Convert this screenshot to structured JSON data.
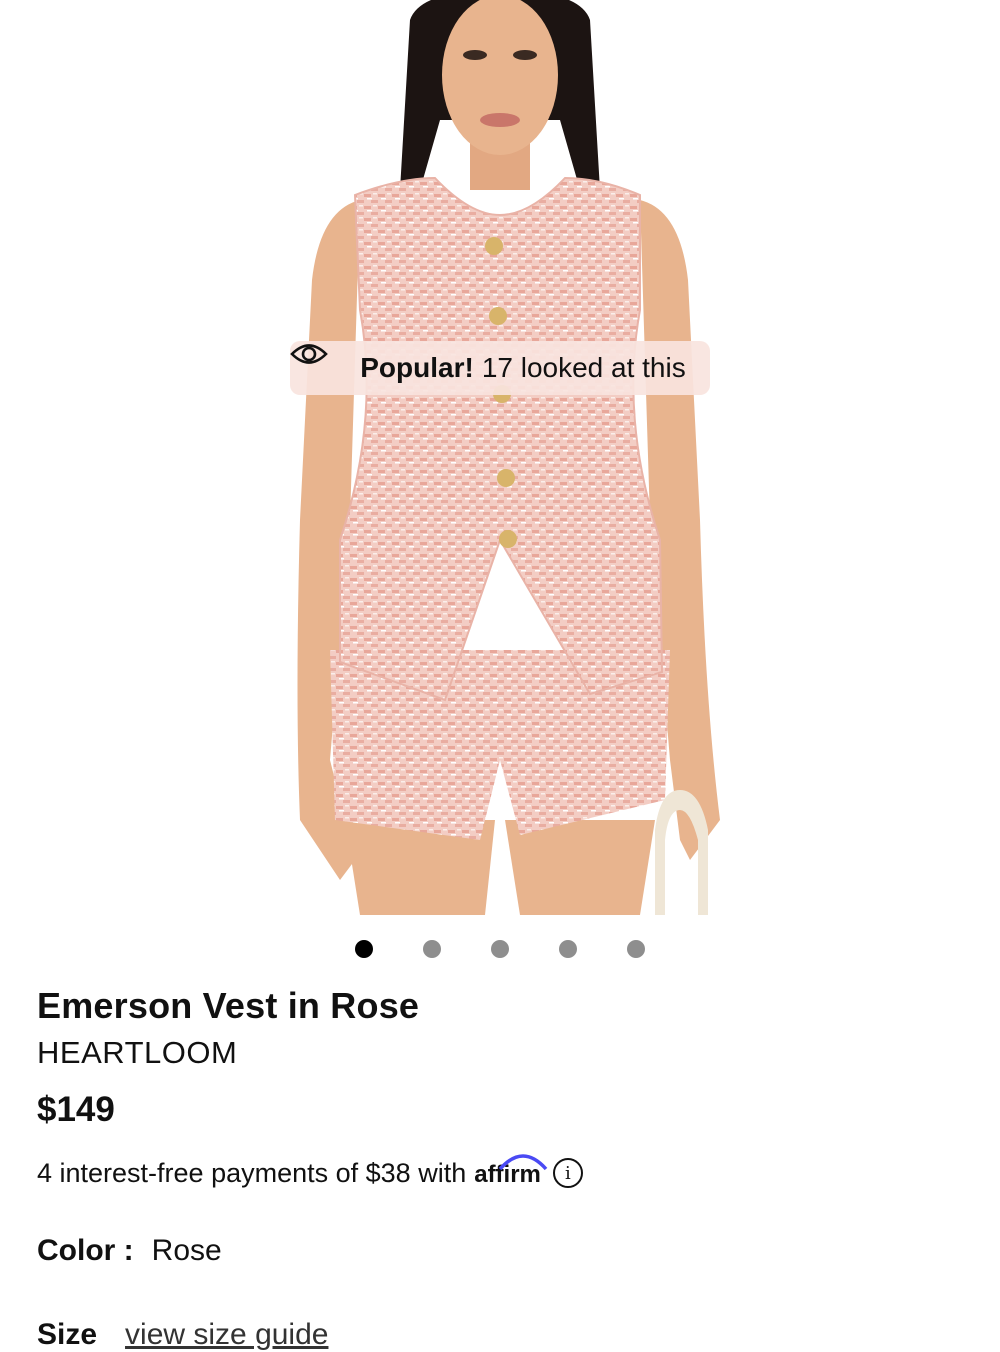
{
  "badge": {
    "icon": "eye-icon",
    "strong": "Popular!",
    "text": "17 looked at this"
  },
  "carousel": {
    "count": 5,
    "active_index": 0
  },
  "product": {
    "title": "Emerson Vest in Rose",
    "brand": "HEARTLOOM",
    "price": "$149",
    "payments_text": "4 interest-free payments of $38 with",
    "affirm_logo": "affirm",
    "color_label": "Color :",
    "color_value": "Rose",
    "size_label": "Size",
    "size_guide": "view size guide"
  },
  "colors": {
    "fabric": "#f2c9c0",
    "skin": "#e8b48e",
    "hair": "#1c1412",
    "dot_inactive": "#8e8e8e",
    "dot_active": "#000000",
    "affirm_blue": "#4a4af4"
  }
}
